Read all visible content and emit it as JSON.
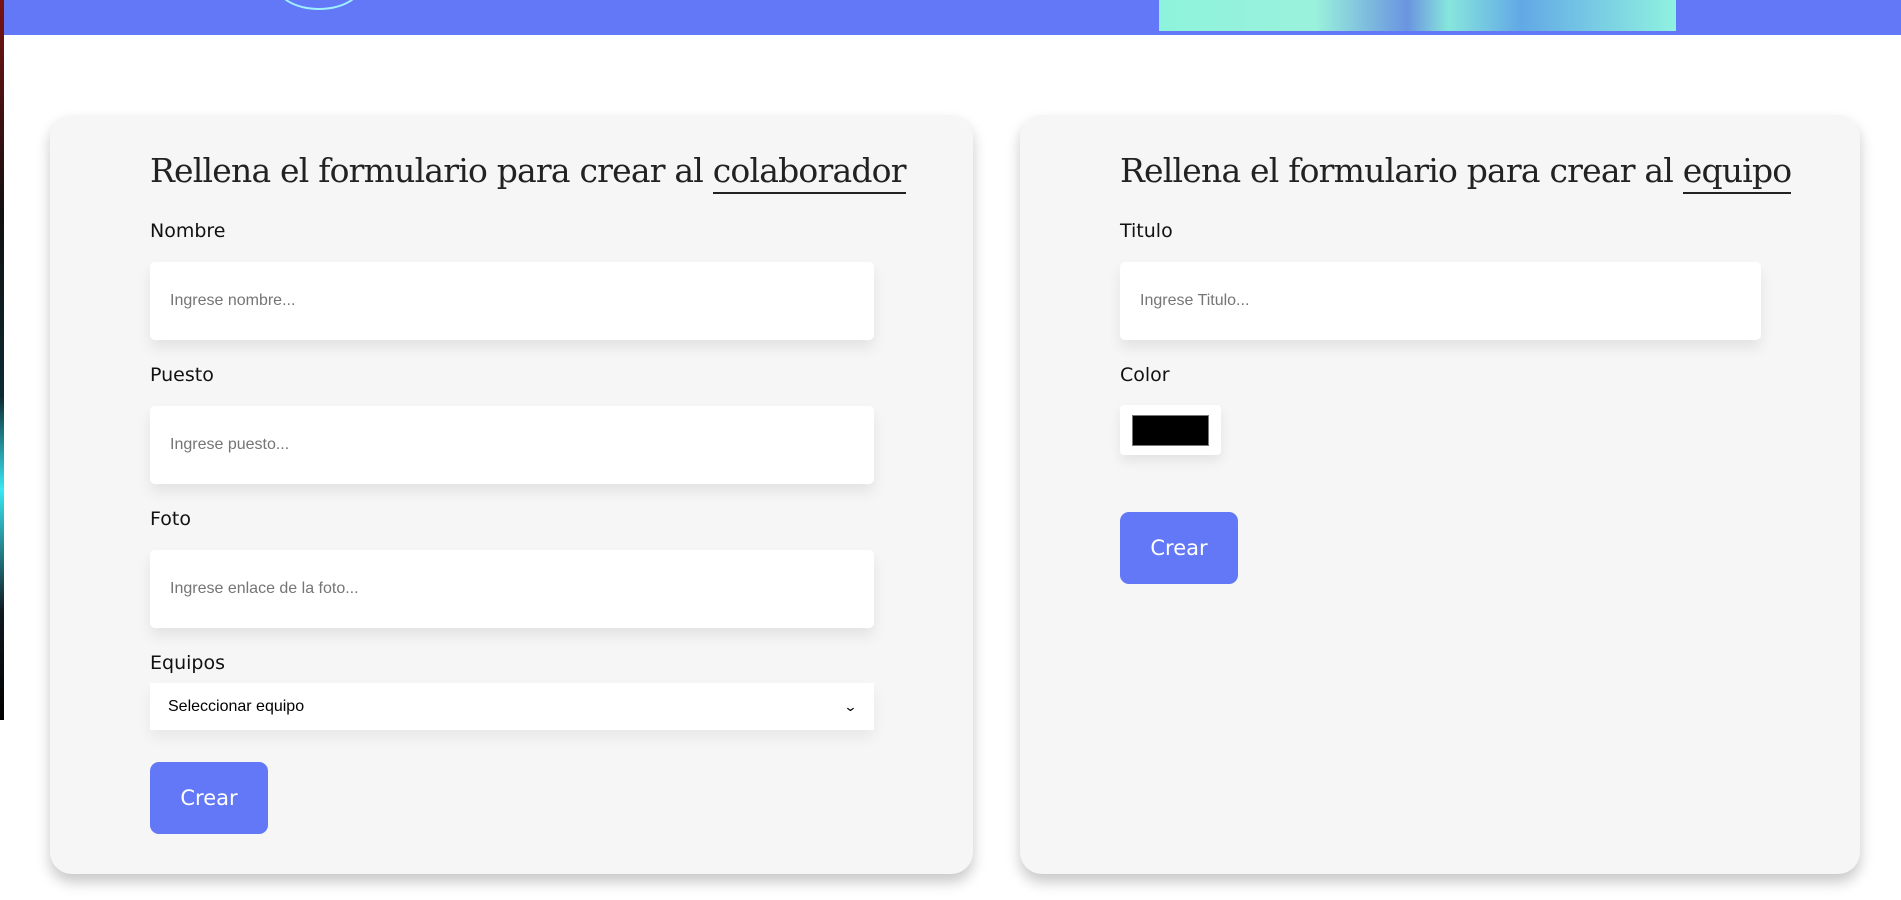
{
  "colors": {
    "accent": "#6378f7",
    "card_background": "#f6f6f6",
    "selected_team_color": "#000000"
  },
  "colaborador_form": {
    "title_prefix": "Rellena el formulario para crear al",
    "title_highlight": "colaborador",
    "nombre_label": "Nombre",
    "nombre_placeholder": "Ingrese nombre...",
    "nombre_value": "",
    "puesto_label": "Puesto",
    "puesto_placeholder": "Ingrese puesto...",
    "puesto_value": "",
    "foto_label": "Foto",
    "foto_placeholder": "Ingrese enlace de la foto...",
    "foto_value": "",
    "equipos_label": "Equipos",
    "equipos_selected": "Seleccionar equipo",
    "submit_label": "Crear"
  },
  "equipo_form": {
    "title_prefix": "Rellena el formulario para crear al",
    "title_highlight": "equipo",
    "titulo_label": "Titulo",
    "titulo_placeholder": "Ingrese Titulo...",
    "titulo_value": "",
    "color_label": "Color",
    "submit_label": "Crear"
  }
}
